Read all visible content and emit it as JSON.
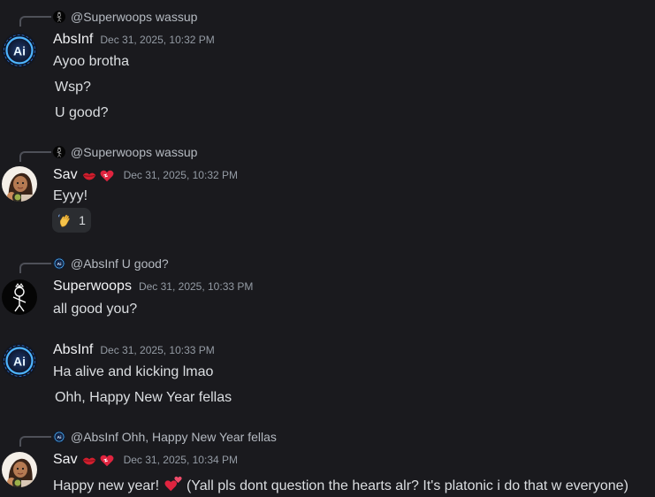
{
  "groups": [
    {
      "reply": {
        "text": "@Superwoops wassup"
      },
      "author": "AbsInf",
      "timestamp": "Dec 31, 2025, 10:32 PM",
      "messages": [
        "Ayoo brotha",
        "Wsp?",
        "U good?"
      ],
      "avatar_icon": "ai-logo-icon"
    },
    {
      "reply": {
        "text": "@Superwoops wassup"
      },
      "author": "Sav",
      "badges": [
        "lips-icon",
        "heart-icon"
      ],
      "timestamp": "Dec 31, 2025, 10:32 PM",
      "messages": [
        "Eyyy!"
      ],
      "reaction": {
        "emoji": "waving-hand-icon",
        "count": "1"
      },
      "avatar_icon": "girl-avatar-icon"
    },
    {
      "reply": {
        "text": "@AbsInf U good?"
      },
      "author": "Superwoops",
      "timestamp": "Dec 31, 2025, 10:33 PM",
      "messages": [
        "all good you?"
      ],
      "avatar_icon": "stick-figure-avatar-icon"
    },
    {
      "author": "AbsInf",
      "timestamp": "Dec 31, 2025, 10:33 PM",
      "messages": [
        "Ha alive and kicking lmao",
        "Ohh, Happy New Year fellas"
      ],
      "avatar_icon": "ai-logo-icon"
    },
    {
      "reply": {
        "text": "@AbsInf Ohh, Happy New Year  fellas"
      },
      "author": "Sav",
      "badges": [
        "lips-icon",
        "heart-icon"
      ],
      "timestamp": "Dec 31, 2025, 10:34 PM",
      "messages": [
        {
          "before": "Happy new year!",
          "emoji": "two-hearts-icon",
          "after": "(Yall pls dont question the hearts alr? It's platonic i do that w everyone)"
        }
      ],
      "avatar_icon": "girl-avatar-icon"
    }
  ],
  "colors": {
    "background": "#1a1a1e",
    "text": "#dbdee1",
    "username": "#f2f3f5",
    "timestamp": "#949ba4",
    "reaction_bg": "#2b2d31",
    "heart": "#e0243f"
  }
}
